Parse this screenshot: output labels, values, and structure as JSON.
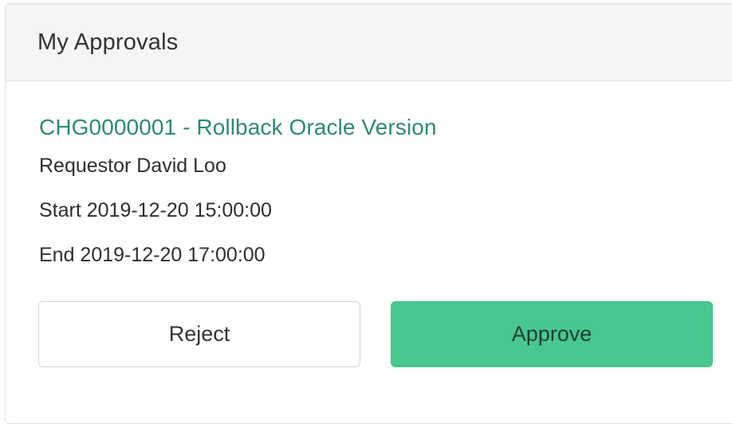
{
  "panel": {
    "title": "My Approvals"
  },
  "approval": {
    "link_text": "CHG0000001 - Rollback Oracle Version",
    "requestor": "Requestor David Loo",
    "start": "Start 2019-12-20 15:00:00",
    "end": "End 2019-12-20 17:00:00"
  },
  "actions": {
    "reject_label": "Reject",
    "approve_label": "Approve"
  },
  "colors": {
    "link": "#2b8a77",
    "approve_bg": "#48c78f",
    "header_bg": "#f5f5f5"
  }
}
